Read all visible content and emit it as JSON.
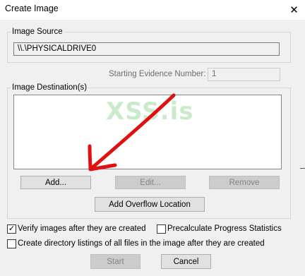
{
  "window": {
    "title": "Create Image",
    "close_symbol": "✕"
  },
  "image_source": {
    "legend": "Image Source",
    "value": "\\\\.\\PHYSICALDRIVE0"
  },
  "evidence": {
    "label": "Starting Evidence Number:",
    "value": "1"
  },
  "image_destination": {
    "legend": "Image Destination(s)"
  },
  "buttons": {
    "add": "Add...",
    "edit": "Edit...",
    "remove": "Remove",
    "add_overflow": "Add Overflow Location",
    "start": "Start",
    "cancel": "Cancel"
  },
  "options": {
    "verify": {
      "label": "Verify images after they are created",
      "checked": true
    },
    "precalculate": {
      "label": "Precalculate Progress Statistics",
      "checked": false
    },
    "directory_listings": {
      "label": "Create directory listings of all files in the image after they are created",
      "checked": false
    }
  },
  "watermark": "XSS.is",
  "colors": {
    "arrow": "#e01010",
    "watermark": "#9fdca0"
  }
}
